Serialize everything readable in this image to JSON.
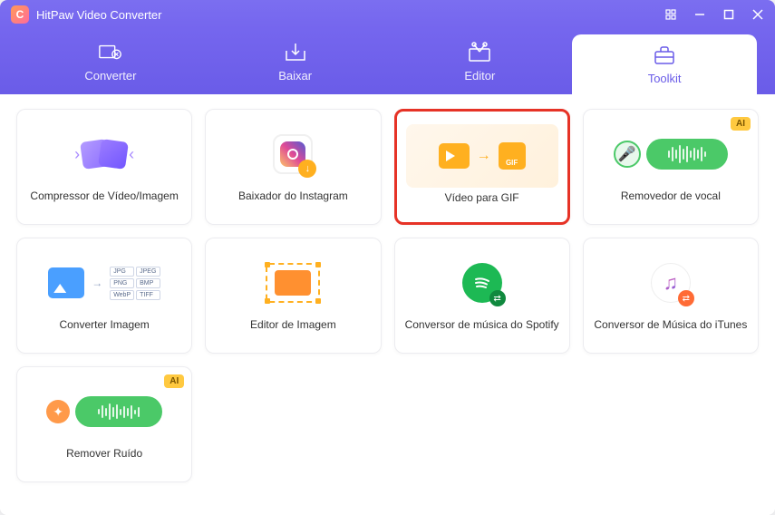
{
  "app": {
    "title": "HitPaw Video Converter",
    "logoLetter": "C"
  },
  "tabs": {
    "converter": "Converter",
    "baixar": "Baixar",
    "editor": "Editor",
    "toolkit": "Toolkit"
  },
  "cards": {
    "compressor": "Compressor de Vídeo/Imagem",
    "instagram": "Baixador do Instagram",
    "videoGif": "Vídeo para GIF",
    "vocalRemover": "Removedor de vocal",
    "imageConverter": "Converter Imagem",
    "imageEditor": "Editor de Imagem",
    "spotify": "Conversor de música do Spotify",
    "itunes": "Conversor de Música do iTunes",
    "noiseRemover": "Remover Ruído"
  },
  "badges": {
    "ai": "AI"
  },
  "formats": [
    "JPG",
    "JPEG",
    "PNG",
    "BMP",
    "WebP",
    "TIFF"
  ],
  "gifLabel": "GIF"
}
